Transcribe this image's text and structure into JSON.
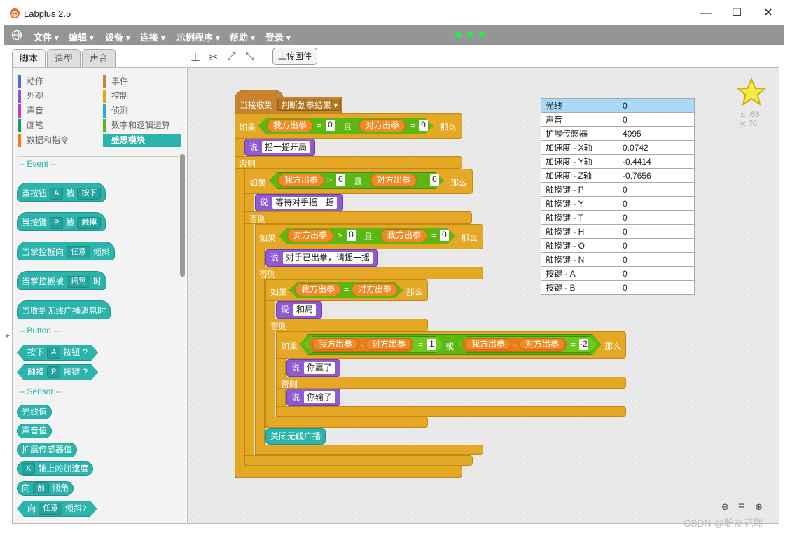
{
  "window": {
    "title": "Labplus 2.5",
    "min": "—",
    "max": "☐",
    "close": "✕"
  },
  "menu": [
    "文件",
    "编辑",
    "设备",
    "连接",
    "示例程序",
    "帮助",
    "登录"
  ],
  "tabs": [
    "脚本",
    "造型",
    "声音"
  ],
  "toolbar": {
    "upload": "上传固件"
  },
  "categories": [
    {
      "label": "动作",
      "color": "#4a6cd4"
    },
    {
      "label": "事件",
      "color": "#c88330"
    },
    {
      "label": "外观",
      "color": "#8a55d7"
    },
    {
      "label": "控制",
      "color": "#e1a91a"
    },
    {
      "label": "声音",
      "color": "#bb42c3"
    },
    {
      "label": "侦测",
      "color": "#2ca5e2"
    },
    {
      "label": "画笔",
      "color": "#0e9a6c"
    },
    {
      "label": "数字和逻辑运算",
      "color": "#5cb712"
    },
    {
      "label": "数据和指令",
      "color": "#ee7d16"
    },
    {
      "label": "盛思模块",
      "color": "#2bb4ac"
    }
  ],
  "palette": {
    "event": "-- Event --",
    "b1": {
      "a": "当按钮",
      "d": "A",
      "b": "被",
      "e": "按下"
    },
    "b2": {
      "a": "当按键",
      "d": "P",
      "b": "被",
      "e": "触摸"
    },
    "b3": {
      "a": "当掌控板向",
      "d": "任意",
      "b": "倾斜"
    },
    "b4": {
      "a": "当掌控板被",
      "d": "摇晃",
      "b": "时"
    },
    "b5": "当收到无线广播消息时",
    "button": "-- Button --",
    "b6": {
      "a": "按下",
      "d": "A",
      "b": "按钮",
      "q": "?"
    },
    "b7": {
      "a": "触摸",
      "d": "P",
      "b": "按键",
      "q": "?"
    },
    "sensor": "-- Sensor --",
    "b8": "光线值",
    "b9": "声音值",
    "b10": "扩展传感器值",
    "b11": {
      "d": "X",
      "b": "轴上的加速度"
    },
    "b12": {
      "a": "向",
      "d": "前",
      "b": "倾角"
    },
    "b13": {
      "a": "向",
      "d": "任意",
      "b": "倾斜?"
    }
  },
  "script": {
    "hat": "当接收到",
    "hatmsg": "判断划拳结果",
    "if": "如果",
    "else": "否则",
    "then": "那么",
    "and": "且",
    "or": "或",
    "say": "说",
    "me": "我方出拳",
    "opp": "对方出拳",
    "eq": "=",
    "gt": ">",
    "minus": "-",
    "zero": "0",
    "one": "1",
    "neg2": "-2",
    "s1": "摇一摇开局",
    "s2": "等待对手摇一摇",
    "s3": "对手已出拳，请摇一摇",
    "s4": "和局",
    "s5": "你赢了",
    "s6": "你输了",
    "close": "关闭无线广播"
  },
  "sensors": [
    {
      "name": "光线",
      "value": "0"
    },
    {
      "name": "声音",
      "value": "0"
    },
    {
      "name": "扩展传感器",
      "value": "4095"
    },
    {
      "name": "加速度 - X轴",
      "value": "0.0742"
    },
    {
      "name": "加速度 - Y轴",
      "value": "-0.4414"
    },
    {
      "name": "加速度 - Z轴",
      "value": "-0.7656"
    },
    {
      "name": "触摸键 - P",
      "value": "0"
    },
    {
      "name": "触摸键 - Y",
      "value": "0"
    },
    {
      "name": "触摸键 - T",
      "value": "0"
    },
    {
      "name": "触摸键 - H",
      "value": "0"
    },
    {
      "name": "触摸键 - O",
      "value": "0"
    },
    {
      "name": "触摸键 - N",
      "value": "0"
    },
    {
      "name": "按键 - A",
      "value": "0"
    },
    {
      "name": "按键 - B",
      "value": "0"
    }
  ],
  "sprite": {
    "x": "x: -58",
    "y": "y: 70"
  },
  "watermark": "CSDN @驴友花雕"
}
